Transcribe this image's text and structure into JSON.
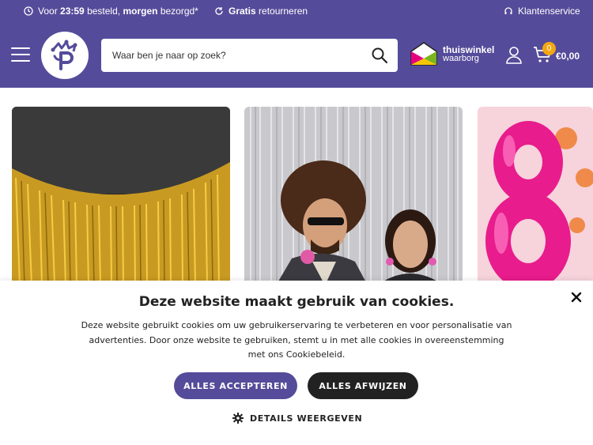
{
  "topbar": {
    "delivery_prefix": "Voor",
    "delivery_time": "23:59",
    "delivery_mid": "besteld,",
    "delivery_when": "morgen",
    "delivery_suffix": "bezorgd*",
    "returns_bold": "Gratis",
    "returns_rest": "retourneren",
    "service": "Klantenservice"
  },
  "header": {
    "search_placeholder": "Waar ben je naar op zoek?",
    "trust_line1": "thuiswinkel",
    "trust_line2": "waarborg",
    "cart_count": "0",
    "cart_total": "€0,00"
  },
  "colors": {
    "brand": "#544c9a",
    "accent": "#f3a712",
    "dark_button": "#222222"
  },
  "products": [
    {
      "image": "gold-fringe-garland"
    },
    {
      "image": "disco-party-couple-silver-curtain"
    },
    {
      "image": "pink-number-8-balloon"
    }
  ],
  "cookie": {
    "title": "Deze website maakt gebruik van cookies.",
    "body": "Deze website gebruikt cookies om uw gebruikerservaring te verbeteren en voor personalisatie van advertenties. Door onze website te gebruiken, stemt u in met alle cookies in overeenstemming met ons Cookiebeleid.",
    "accept": "ALLES ACCEPTEREN",
    "reject": "ALLES AFWIJZEN",
    "details": "DETAILS WEERGEVEN"
  },
  "icons": [
    "clock-icon",
    "refresh-icon",
    "headset-icon",
    "menu-icon",
    "search-icon",
    "user-icon",
    "cart-icon",
    "close-icon",
    "gear-icon"
  ]
}
